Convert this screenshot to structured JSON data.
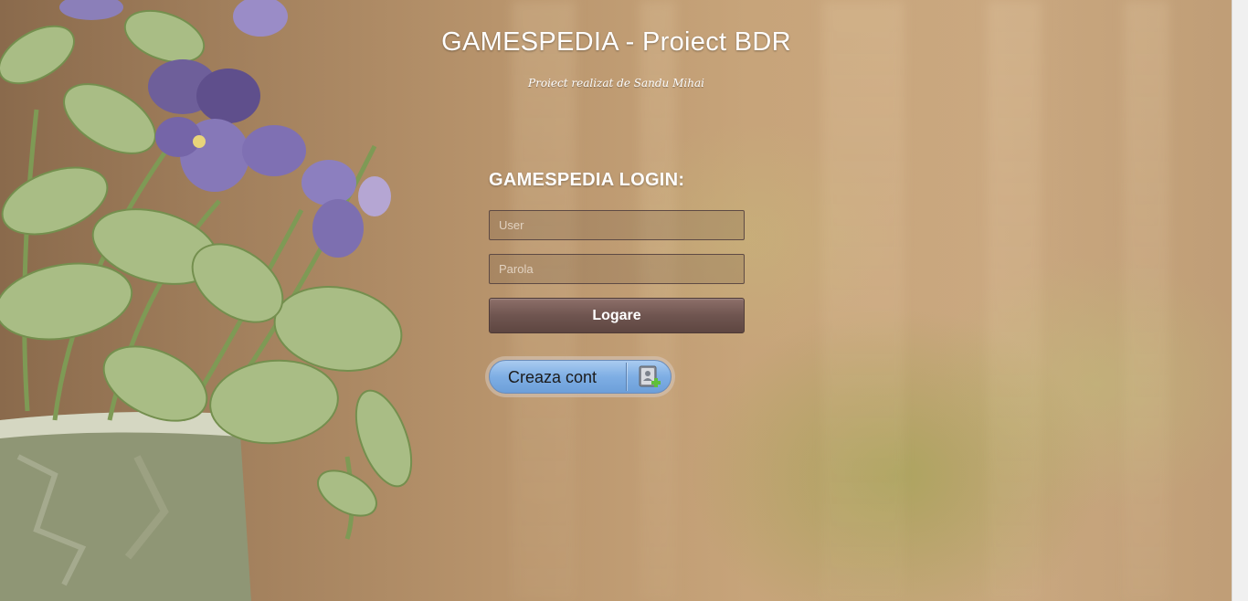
{
  "header": {
    "title": "GAMESPEDIA - Proiect BDR",
    "subtitle": "Proiect realizat de Sandu Mihai"
  },
  "login": {
    "heading": "GAMESPEDIA LOGIN:",
    "user_placeholder": "User",
    "password_placeholder": "Parola",
    "submit_label": "Logare"
  },
  "create_account": {
    "label": "Creaza cont",
    "icon": "address-book-add-icon"
  },
  "colors": {
    "submit_button": "#6f5550",
    "create_button": "#7eaee4",
    "text": "#ffffff"
  }
}
